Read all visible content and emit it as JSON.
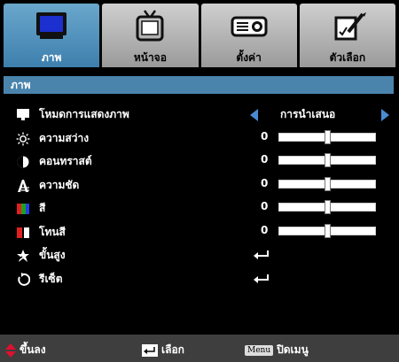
{
  "tabs": [
    {
      "label": "ภาพ",
      "icon": "monitor-icon",
      "active": true
    },
    {
      "label": "หน้าจอ",
      "icon": "tv-icon",
      "active": false
    },
    {
      "label": "ตั้งค่า",
      "icon": "projector-icon",
      "active": false
    },
    {
      "label": "ตัวเลือก",
      "icon": "options-icon",
      "active": false
    }
  ],
  "section_title": "ภาพ",
  "display_mode": {
    "label": "โหมดการแสดงภาพ",
    "value": "การนำเสนอ"
  },
  "settings": [
    {
      "label": "ความสว่าง",
      "value": "0",
      "level": 0.5,
      "icon": "brightness-icon"
    },
    {
      "label": "คอนทราสต์",
      "value": "0",
      "level": 0.5,
      "icon": "contrast-icon"
    },
    {
      "label": "ความชัด",
      "value": "0",
      "level": 0.5,
      "icon": "sharpness-icon"
    },
    {
      "label": "สี",
      "value": "0",
      "level": 0.5,
      "icon": "color-icon"
    },
    {
      "label": "โทนสี",
      "value": "0",
      "level": 0.5,
      "icon": "tint-icon"
    }
  ],
  "advanced": {
    "label": "ขั้นสูง",
    "icon": "advanced-icon"
  },
  "reset": {
    "label": "รีเซ็ต",
    "icon": "reset-icon"
  },
  "footer": {
    "navigate": "ขึ้นลง",
    "select": "เลือก",
    "menu_key": "Menu",
    "close": "ปิดเมนู"
  },
  "colors": {
    "accent": "#4a84ad",
    "active_tab": "#5b9ac0",
    "arrow": "#4a8ad2",
    "background": "#000000"
  }
}
